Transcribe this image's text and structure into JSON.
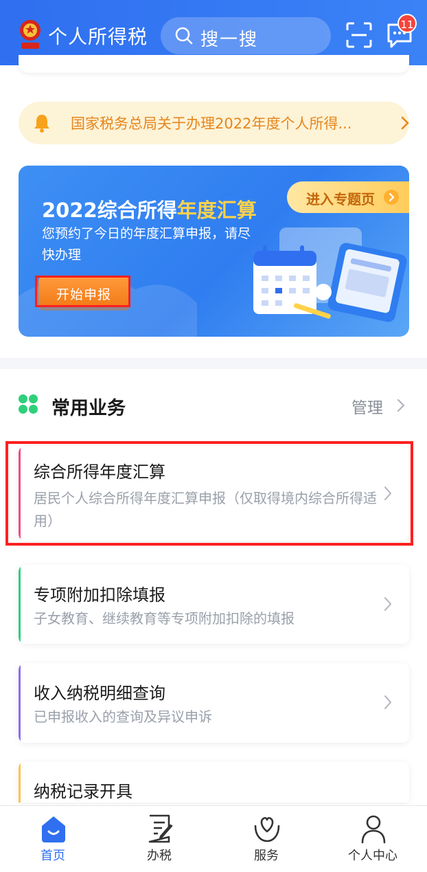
{
  "header": {
    "title": "个人所得税",
    "search_placeholder": "搜一搜",
    "message_badge": "11"
  },
  "notice": {
    "text": "国家税务总局关于办理2022年度个人所得..."
  },
  "banner": {
    "title_prefix": "2022综合所得",
    "title_highlight": "年度汇算",
    "subtitle": "您预约了今日的年度汇算申报，请尽快办理",
    "topic_button": "进入专题页",
    "start_button": "开始申报"
  },
  "section": {
    "title": "常用业务",
    "manage_label": "管理"
  },
  "services": [
    {
      "title": "综合所得年度汇算",
      "desc": "居民个人综合所得年度汇算申报（仅取得境内综合所得适用）",
      "accent": "#f04a7e"
    },
    {
      "title": "专项附加扣除填报",
      "desc": "子女教育、继续教育等专项附加扣除的填报",
      "accent": "#2fd07a"
    },
    {
      "title": "收入纳税明细查询",
      "desc": "已申报收入的查询及异议申诉",
      "accent": "#8b6cf0"
    },
    {
      "title": "纳税记录开具",
      "desc": "",
      "accent": "#ffc24a"
    }
  ],
  "tabs": [
    {
      "label": "首页",
      "icon": "home-icon",
      "active": true
    },
    {
      "label": "办税",
      "icon": "document-edit-icon",
      "active": false
    },
    {
      "label": "服务",
      "icon": "heart-hands-icon",
      "active": false
    },
    {
      "label": "个人中心",
      "icon": "person-icon",
      "active": false
    }
  ],
  "colors": {
    "primary": "#2f6ff0",
    "highlight_box": "#ff1f1f",
    "notice_text": "#e6861c"
  }
}
